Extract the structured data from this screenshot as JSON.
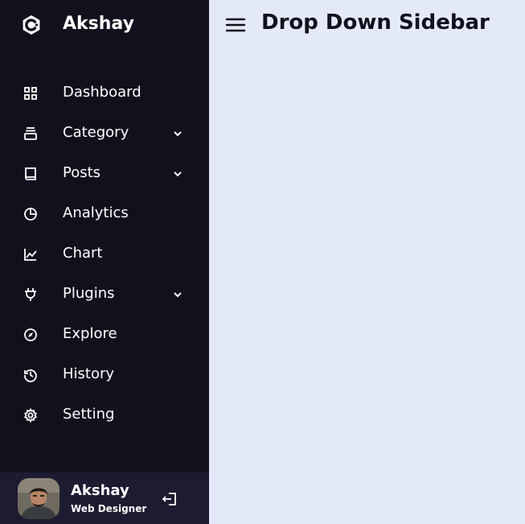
{
  "brand": {
    "name": "Akshay",
    "icon": "brand-logo-icon"
  },
  "nav": {
    "items": [
      {
        "label": "Dashboard",
        "icon": "grid-icon",
        "has_submenu": false
      },
      {
        "label": "Category",
        "icon": "collection-icon",
        "has_submenu": true
      },
      {
        "label": "Posts",
        "icon": "book-icon",
        "has_submenu": true
      },
      {
        "label": "Analytics",
        "icon": "pie-chart-icon",
        "has_submenu": false
      },
      {
        "label": "Chart",
        "icon": "line-chart-icon",
        "has_submenu": false
      },
      {
        "label": "Plugins",
        "icon": "plug-icon",
        "has_submenu": true
      },
      {
        "label": "Explore",
        "icon": "compass-icon",
        "has_submenu": false
      },
      {
        "label": "History",
        "icon": "history-icon",
        "has_submenu": false
      },
      {
        "label": "Setting",
        "icon": "cog-icon",
        "has_submenu": false
      }
    ]
  },
  "profile": {
    "name": "Akshay",
    "job": "Web Designer",
    "logout_icon": "logout-icon"
  },
  "header": {
    "title": "Drop Down Sidebar",
    "menu_icon": "menu-icon"
  },
  "colors": {
    "sidebar_bg": "#11101d",
    "profile_bg": "#1d1b31",
    "content_bg": "#e4e9f7",
    "title_text": "#11101d",
    "sidebar_text": "#ffffff"
  }
}
